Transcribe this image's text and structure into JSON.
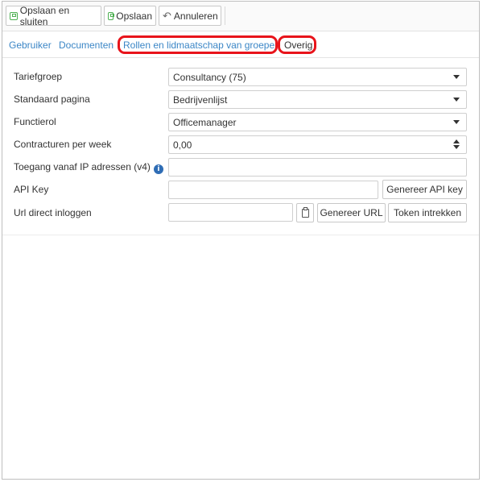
{
  "toolbar": {
    "save_close_label": "Opslaan en sluiten",
    "save_label": "Opslaan",
    "cancel_label": "Annuleren"
  },
  "tabs": [
    {
      "label": "Gebruiker"
    },
    {
      "label": "Documenten"
    },
    {
      "label": "Rollen en lidmaatschap van groepen"
    },
    {
      "label": "Overig"
    }
  ],
  "form": {
    "tariefgroep": {
      "label": "Tariefgroep",
      "value": "Consultancy (75)"
    },
    "standaard_pagina": {
      "label": "Standaard pagina",
      "value": "Bedrijvenlijst"
    },
    "functierol": {
      "label": "Functierol",
      "value": "Officemanager"
    },
    "contracturen": {
      "label": "Contracturen per week",
      "value": "0,00"
    },
    "ip": {
      "label": "Toegang vanaf IP adressen (v4)",
      "value": ""
    },
    "api_key": {
      "label": "API Key",
      "value": "",
      "button": "Genereer API key"
    },
    "url": {
      "label": "Url direct inloggen",
      "value": "",
      "generate_button": "Genereer URL",
      "revoke_button": "Token intrekken"
    }
  },
  "colors": {
    "link": "#3b86c6",
    "highlight": "#e8141b",
    "save_icon": "#4caf50"
  }
}
